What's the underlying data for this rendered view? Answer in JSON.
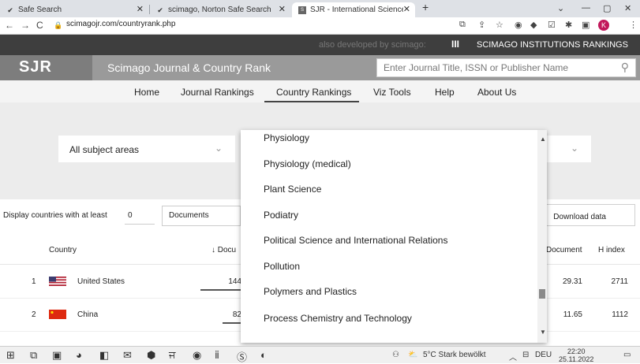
{
  "browser": {
    "tabs": [
      {
        "title": "Safe Search",
        "icon": "check-icon",
        "active": false
      },
      {
        "title": "scimago, Norton Safe Search",
        "icon": "check-icon",
        "active": false
      },
      {
        "title": "SJR - International Science Rank",
        "icon": "sjr-favicon",
        "active": true
      }
    ],
    "new_tab": "+",
    "url": "scimagojr.com/countryrank.php"
  },
  "site": {
    "also_developed": "also developed by scimago:",
    "institutions_logo": "III",
    "institutions_label": "SCIMAGO INSTITUTIONS RANKINGS",
    "logo": "SJR",
    "title": "Scimago Journal & Country Rank",
    "search_placeholder": "Enter Journal Title, ISSN or Publisher Name"
  },
  "nav": {
    "home": "Home",
    "journal_rankings": "Journal Rankings",
    "country_rankings": "Country Rankings",
    "viz_tools": "Viz Tools",
    "help": "Help",
    "about": "About Us"
  },
  "filters": {
    "subject_area": "All subject areas"
  },
  "display": {
    "label": "Display countries with at least",
    "min_value": "0",
    "metric": "Documents",
    "download": "Download data"
  },
  "table": {
    "headers": {
      "country": "Country",
      "documents": "↓ Docu",
      "citations_per_doc": "Document",
      "h_index": "H index"
    },
    "rows": [
      {
        "rank": "1",
        "country": "United States",
        "documents": "144",
        "citations_per_doc": "29.31",
        "h_index": "2711",
        "flag": "us-flag-icon"
      },
      {
        "rank": "2",
        "country": "China",
        "documents": "82",
        "citations_per_doc": "11.65",
        "h_index": "1112",
        "flag": "china-flag-icon"
      }
    ]
  },
  "dropdown": {
    "options": [
      "Physiology",
      "Physiology (medical)",
      "Plant Science",
      "Podiatry",
      "Political Science and International Relations",
      "Pollution",
      "Polymers and Plastics",
      "Process Chemistry and Technology"
    ]
  },
  "taskbar": {
    "weather": "5°C Stark bewölkt",
    "language": "DEU",
    "time": "22:20",
    "date": "25.11.2022"
  }
}
